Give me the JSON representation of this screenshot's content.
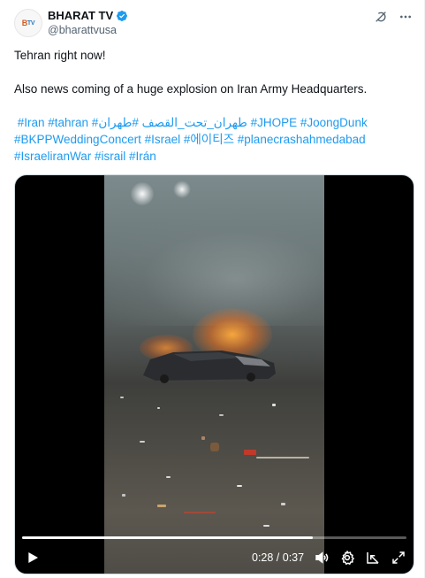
{
  "post": {
    "author": {
      "avatar_text_b": "B",
      "avatar_text_tv": "TV",
      "display_name": "BHARAT TV",
      "handle": "@bharattvusa",
      "verified": true
    },
    "icons": [
      "grok-icon",
      "more-icon"
    ],
    "text_line_1": "Tehran right now!",
    "text_line_2": "Also news coming of a huge explosion on Iran Army Headquarters.",
    "hashtags_line_1": " #Iran #tahran #طهران_تحت_القصف #طهران #JHOPE #JoongDunk",
    "hashtags_line_2": "#BKPPWeddingConcert #Israel #에이티즈 #planecrashahmedabad",
    "hashtags_line_3": "#IsraeliranWar #israil #Irán"
  },
  "video": {
    "progress": 0.757,
    "time_display": "0:28 / 0:37",
    "controls": [
      "play-icon",
      "volume-icon",
      "settings-icon",
      "popout-icon",
      "fullscreen-icon"
    ]
  },
  "colors": {
    "link": "#1d9bf0",
    "verified": "#1d9bf0",
    "secondary_text": "#536471"
  }
}
